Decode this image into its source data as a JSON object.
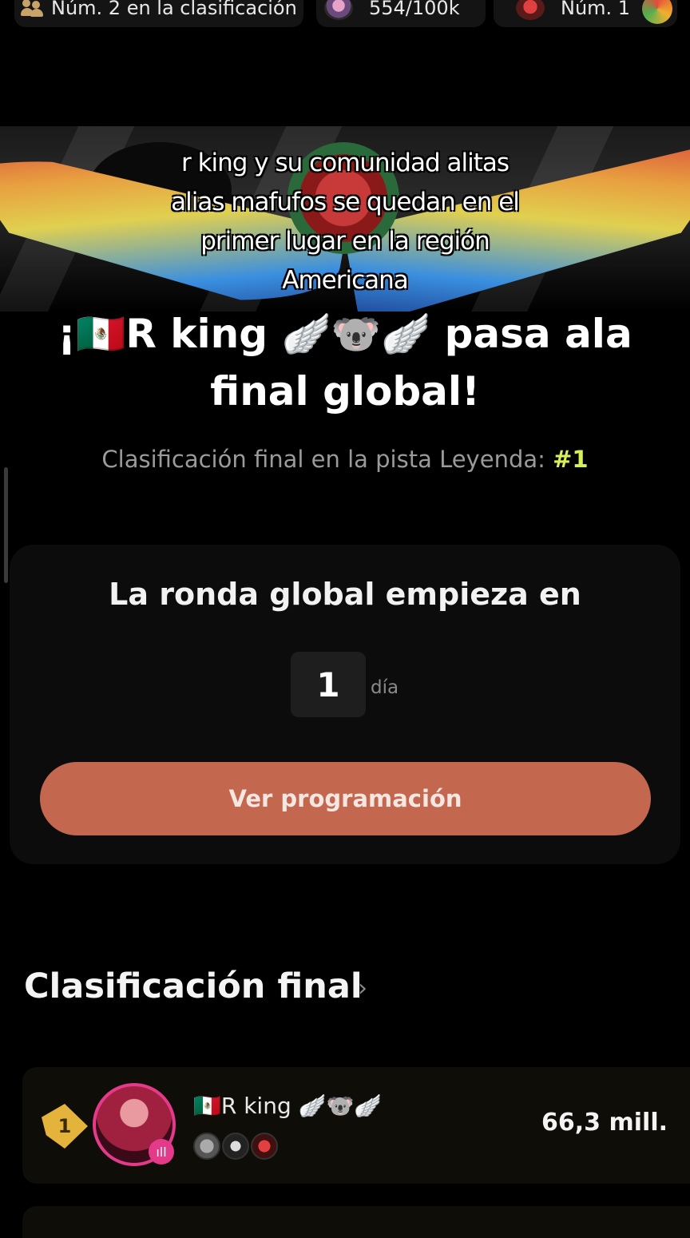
{
  "top_bar": {
    "rank_label": "Núm. 2 en la clasificación",
    "viewers_count": "554/100k",
    "num_label": "Núm. 1"
  },
  "banner": {
    "caption_lines": [
      "r king y su comunidad alitas",
      "alias mafufos se quedan en el",
      "primer lugar en la región",
      "Americana"
    ]
  },
  "headline": "¡🇲🇽R king 🪽🐨🪽 pasa ala final global!",
  "subline": {
    "label": "Clasificación final en la pista Leyenda:",
    "rank": "#1"
  },
  "countdown_card": {
    "title": "La ronda global empieza en",
    "value": "1",
    "unit": "día",
    "button_label": "Ver programación"
  },
  "final_section": {
    "title": "Clasificación final",
    "chevron": "›",
    "rows": [
      {
        "rank": "1",
        "name": "🇲🇽R king 🪽🐨🪽",
        "score": "66,3 mill."
      }
    ]
  },
  "colors": {
    "accent_button": "#c4674f",
    "rank_highlight": "#d6f05a",
    "avatar_ring": "#e33a8a",
    "rank_badge": "#e4b33c"
  }
}
